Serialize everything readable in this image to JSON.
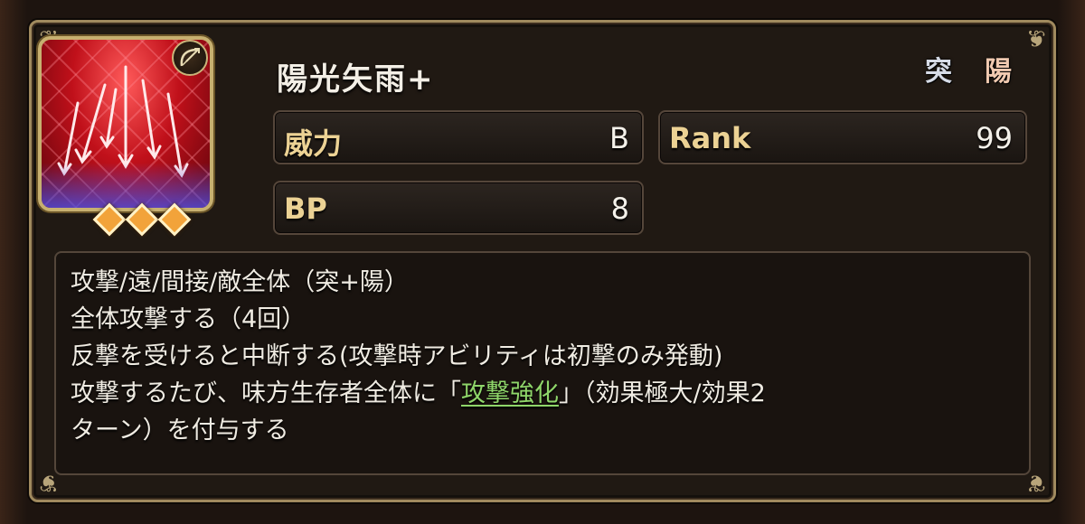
{
  "skill": {
    "name": "陽光矢雨+",
    "icon": "rain-of-arrows-skill-icon",
    "weapon_icon": "bow-icon",
    "rank_diamonds": 3,
    "attributes": [
      {
        "name": "thrust-attribute-icon",
        "glyph": "突"
      },
      {
        "name": "sun-attribute-icon",
        "glyph": "陽"
      }
    ]
  },
  "stats": {
    "power_label": "威力",
    "power_value": "B",
    "rank_label": "Rank",
    "rank_value": "99",
    "bp_label": "BP",
    "bp_value": "8"
  },
  "description": {
    "line1": "攻撃/遠/間接/敵全体（突+陽）",
    "line2": "全体攻撃する（4回）",
    "line3": "反撃を受けると中断する(攻撃時アビリティは初撃のみ発動)",
    "line4_before": "攻撃するたび、味方生存者全体に「",
    "line4_buff": "攻撃強化",
    "line4_after": "」（効果極大/効果2",
    "line5": "ターン）を付与する"
  },
  "colors": {
    "label_gold": "#ecd294",
    "buff_green": "#8fd66a",
    "frame_gold": "#a08a5e"
  }
}
